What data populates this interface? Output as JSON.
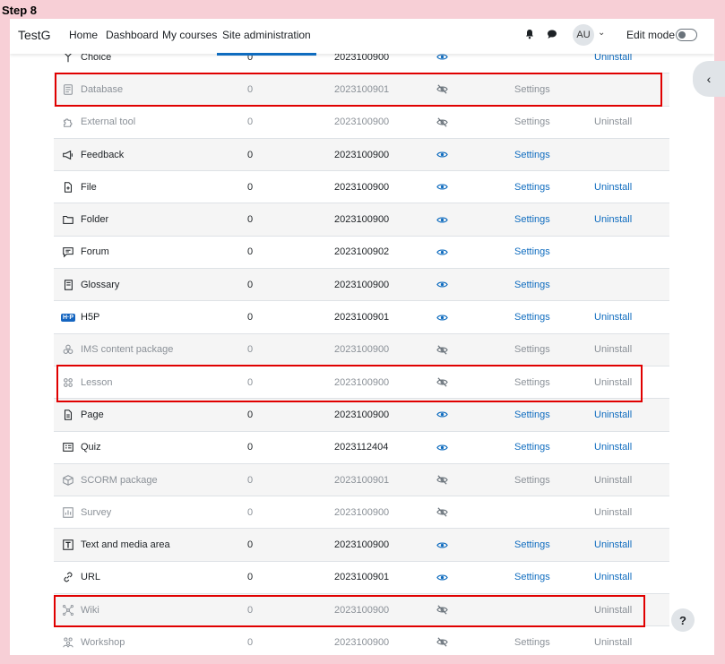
{
  "step_label": "Step 8",
  "navbar": {
    "brand": "TestG",
    "links": [
      "Home",
      "Dashboard",
      "My courses",
      "Site administration"
    ],
    "active_index": 3,
    "avatar_initials": "AU",
    "edit_mode_label": "Edit mode"
  },
  "plugins": [
    {
      "name": "Choice",
      "count": "0",
      "version": "2023100900",
      "visible": true,
      "settings": "",
      "uninstall": "Uninstall",
      "icon": "choice-icon",
      "dim": false
    },
    {
      "name": "Database",
      "count": "0",
      "version": "2023100901",
      "visible": false,
      "settings": "Settings",
      "uninstall": "",
      "icon": "database-icon",
      "dim": true
    },
    {
      "name": "External tool",
      "count": "0",
      "version": "2023100900",
      "visible": false,
      "settings": "Settings",
      "uninstall": "Uninstall",
      "icon": "puzzle-icon",
      "dim": true
    },
    {
      "name": "Feedback",
      "count": "0",
      "version": "2023100900",
      "visible": true,
      "settings": "Settings",
      "uninstall": "",
      "icon": "megaphone-icon",
      "dim": false
    },
    {
      "name": "File",
      "count": "0",
      "version": "2023100900",
      "visible": true,
      "settings": "Settings",
      "uninstall": "Uninstall",
      "icon": "file-icon",
      "dim": false
    },
    {
      "name": "Folder",
      "count": "0",
      "version": "2023100900",
      "visible": true,
      "settings": "Settings",
      "uninstall": "Uninstall",
      "icon": "folder-icon",
      "dim": false
    },
    {
      "name": "Forum",
      "count": "0",
      "version": "2023100902",
      "visible": true,
      "settings": "Settings",
      "uninstall": "",
      "icon": "forum-icon",
      "dim": false
    },
    {
      "name": "Glossary",
      "count": "0",
      "version": "2023100900",
      "visible": true,
      "settings": "Settings",
      "uninstall": "",
      "icon": "glossary-icon",
      "dim": false
    },
    {
      "name": "H5P",
      "count": "0",
      "version": "2023100901",
      "visible": true,
      "settings": "Settings",
      "uninstall": "Uninstall",
      "icon": "h5p-icon",
      "dim": false
    },
    {
      "name": "IMS content package",
      "count": "0",
      "version": "2023100900",
      "visible": false,
      "settings": "Settings",
      "uninstall": "Uninstall",
      "icon": "ims-package-icon",
      "dim": true
    },
    {
      "name": "Lesson",
      "count": "0",
      "version": "2023100900",
      "visible": false,
      "settings": "Settings",
      "uninstall": "Uninstall",
      "icon": "lesson-icon",
      "dim": true
    },
    {
      "name": "Page",
      "count": "0",
      "version": "2023100900",
      "visible": true,
      "settings": "Settings",
      "uninstall": "Uninstall",
      "icon": "page-icon",
      "dim": false
    },
    {
      "name": "Quiz",
      "count": "0",
      "version": "2023112404",
      "visible": true,
      "settings": "Settings",
      "uninstall": "Uninstall",
      "icon": "quiz-icon",
      "dim": false
    },
    {
      "name": "SCORM package",
      "count": "0",
      "version": "2023100901",
      "visible": false,
      "settings": "Settings",
      "uninstall": "Uninstall",
      "icon": "scorm-icon",
      "dim": true
    },
    {
      "name": "Survey",
      "count": "0",
      "version": "2023100900",
      "visible": false,
      "settings": "",
      "uninstall": "Uninstall",
      "icon": "survey-icon",
      "dim": true
    },
    {
      "name": "Text and media area",
      "count": "0",
      "version": "2023100900",
      "visible": true,
      "settings": "Settings",
      "uninstall": "Uninstall",
      "icon": "text-media-icon",
      "dim": false
    },
    {
      "name": "URL",
      "count": "0",
      "version": "2023100901",
      "visible": true,
      "settings": "Settings",
      "uninstall": "Uninstall",
      "icon": "link-icon",
      "dim": false
    },
    {
      "name": "Wiki",
      "count": "0",
      "version": "2023100900",
      "visible": false,
      "settings": "",
      "uninstall": "Uninstall",
      "icon": "wiki-icon",
      "dim": true
    },
    {
      "name": "Workshop",
      "count": "0",
      "version": "2023100900",
      "visible": false,
      "settings": "Settings",
      "uninstall": "Uninstall",
      "icon": "workshop-icon",
      "dim": true
    }
  ],
  "highlighted_rows": [
    "Database",
    "Lesson",
    "Wiki"
  ],
  "help_label": "?",
  "colors": {
    "link": "#0f6cbf",
    "highlight": "#e00000",
    "background": "#f7cfd6"
  }
}
